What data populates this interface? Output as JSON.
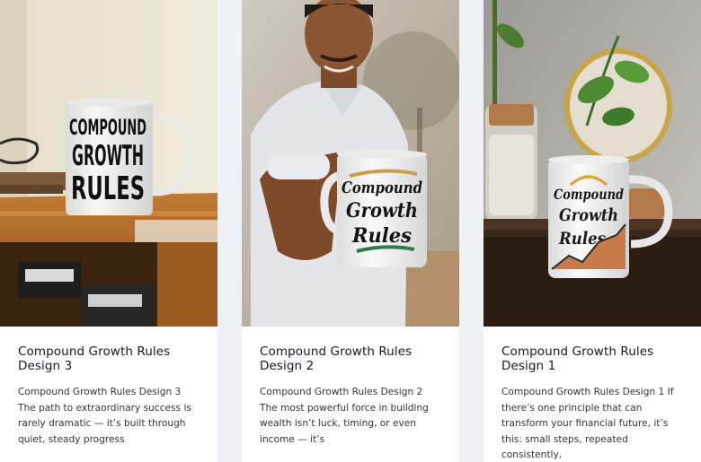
{
  "products": [
    {
      "title": "Compound Growth Rules Design 3",
      "description": "Compound Growth Rules Design 3 The path to extraordinary success is rarely dramatic — it’s built through quiet, steady progress",
      "mug_text": [
        "COMPOUND",
        "GROWTH",
        "RULES"
      ]
    },
    {
      "title": "Compound Growth Rules Design 2",
      "description": "Compound Growth Rules Design 2 The most powerful force in building wealth isn’t luck, timing, or even income — it’s",
      "mug_text": [
        "Compound",
        "Growth",
        "Rules"
      ]
    },
    {
      "title": "Compound Growth Rules Design 1",
      "description": "Compound Growth Rules Design 1 If there’s one principle that can transform your financial future, it’s this: small steps, repeated consistently,",
      "mug_text": [
        "Compound",
        "Growth",
        "Rules"
      ]
    }
  ],
  "colors": {
    "page_background": "#eef1f6",
    "card_background": "#ffffff",
    "title_text": "#111827",
    "body_text": "#30343c",
    "wood": "#b5651d",
    "mug_white": "#f4f4f2"
  }
}
